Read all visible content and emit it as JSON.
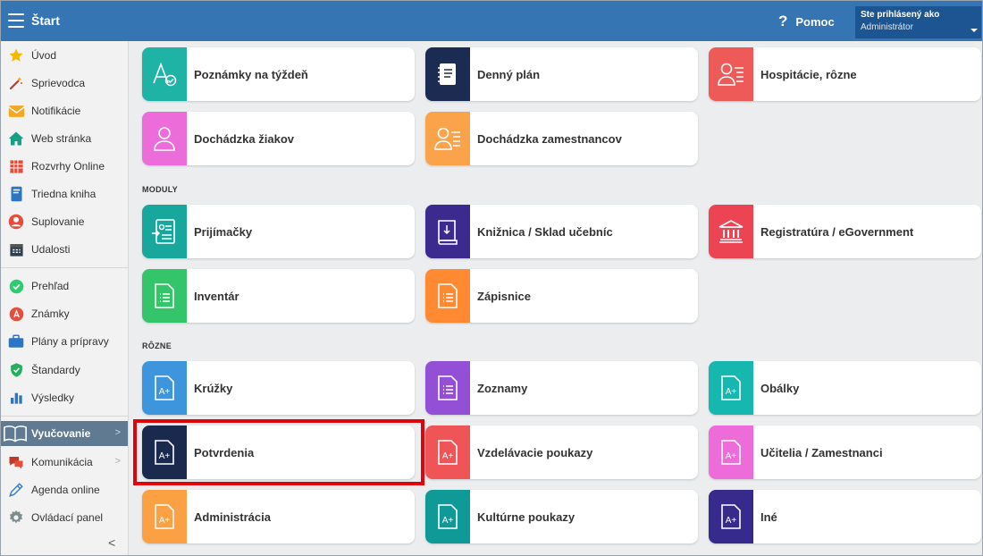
{
  "header": {
    "title": "Štart",
    "help_label": "Pomoc",
    "user_line1": "Ste prihlásený ako",
    "user_line2": "Administrátor"
  },
  "sidebar": {
    "items": [
      {
        "label": "Úvod",
        "icon": "star-icon"
      },
      {
        "label": "Sprievodca",
        "icon": "magic-wand-icon"
      },
      {
        "label": "Notifikácie",
        "icon": "envelope-icon"
      },
      {
        "label": "Web stránka",
        "icon": "home-icon"
      },
      {
        "label": "Rozvrhy Online",
        "icon": "calendar-grid-icon"
      },
      {
        "label": "Triedna kniha",
        "icon": "book-icon"
      },
      {
        "label": "Suplovanie",
        "icon": "user-swap-icon"
      },
      {
        "label": "Udalosti",
        "icon": "calendar-icon"
      },
      {
        "label": "Prehľad",
        "icon": "check-circle-icon"
      },
      {
        "label": "Známky",
        "icon": "grade-icon"
      },
      {
        "label": "Plány a prípravy",
        "icon": "briefcase-icon"
      },
      {
        "label": "Štandardy",
        "icon": "shield-check-icon"
      },
      {
        "label": "Výsledky",
        "icon": "bar-chart-icon"
      },
      {
        "label": "Vyučovanie",
        "icon": "open-book-icon",
        "active": true
      },
      {
        "label": "Komunikácia",
        "icon": "chat-icon"
      },
      {
        "label": "Agenda online",
        "icon": "pen-icon"
      },
      {
        "label": "Ovládací panel",
        "icon": "gear-icon"
      }
    ]
  },
  "sections": {
    "moduly": "MODULY",
    "rozne": "RÔZNE"
  },
  "tiles": [
    {
      "label": "Poznámky na týždeň",
      "color": "#1fb3a6",
      "icon": "font-check-icon"
    },
    {
      "label": "Denný plán",
      "color": "#1b2b52",
      "icon": "notebook-icon"
    },
    {
      "label": "Hospitácie, rôzne",
      "color": "#ee5a57",
      "icon": "person-list-icon"
    },
    {
      "label": "Dochádzka žiakov",
      "color": "#ec6cd9",
      "icon": "person-icon"
    },
    {
      "label": "Dochádzka zamestnancov",
      "color": "#fba34a",
      "icon": "person-list-icon"
    },
    {
      "label": "Prijímačky",
      "color": "#17a79d",
      "icon": "id-card-icon"
    },
    {
      "label": "Knižnica / Sklad učebníc",
      "color": "#3c2a8f",
      "icon": "book-download-icon"
    },
    {
      "label": "Registratúra / eGovernment",
      "color": "#ec4452",
      "icon": "bank-icon"
    },
    {
      "label": "Inventár",
      "color": "#34c46a",
      "icon": "document-list-icon"
    },
    {
      "label": "Zápisnice",
      "color": "#ff8a32",
      "icon": "document-list-icon"
    },
    {
      "label": "Krúžky",
      "color": "#3d96dd",
      "icon": "grade-document-icon"
    },
    {
      "label": "Zoznamy",
      "color": "#9350d6",
      "icon": "document-list-icon"
    },
    {
      "label": "Obálky",
      "color": "#16b7ae",
      "icon": "grade-document-icon"
    },
    {
      "label": "Potvrdenia",
      "color": "#1a2a4f",
      "icon": "grade-document-icon"
    },
    {
      "label": "Vzdelávacie poukazy",
      "color": "#ef5557",
      "icon": "grade-document-icon"
    },
    {
      "label": "Učitelia / Zamestnanci",
      "color": "#ee6cd9",
      "icon": "grade-document-icon"
    },
    {
      "label": "Administrácia",
      "color": "#fba143",
      "icon": "grade-document-icon"
    },
    {
      "label": "Kultúrne poukazy",
      "color": "#0f9a98",
      "icon": "grade-document-icon"
    },
    {
      "label": "Iné",
      "color": "#372a8d",
      "icon": "grade-document-icon"
    }
  ]
}
